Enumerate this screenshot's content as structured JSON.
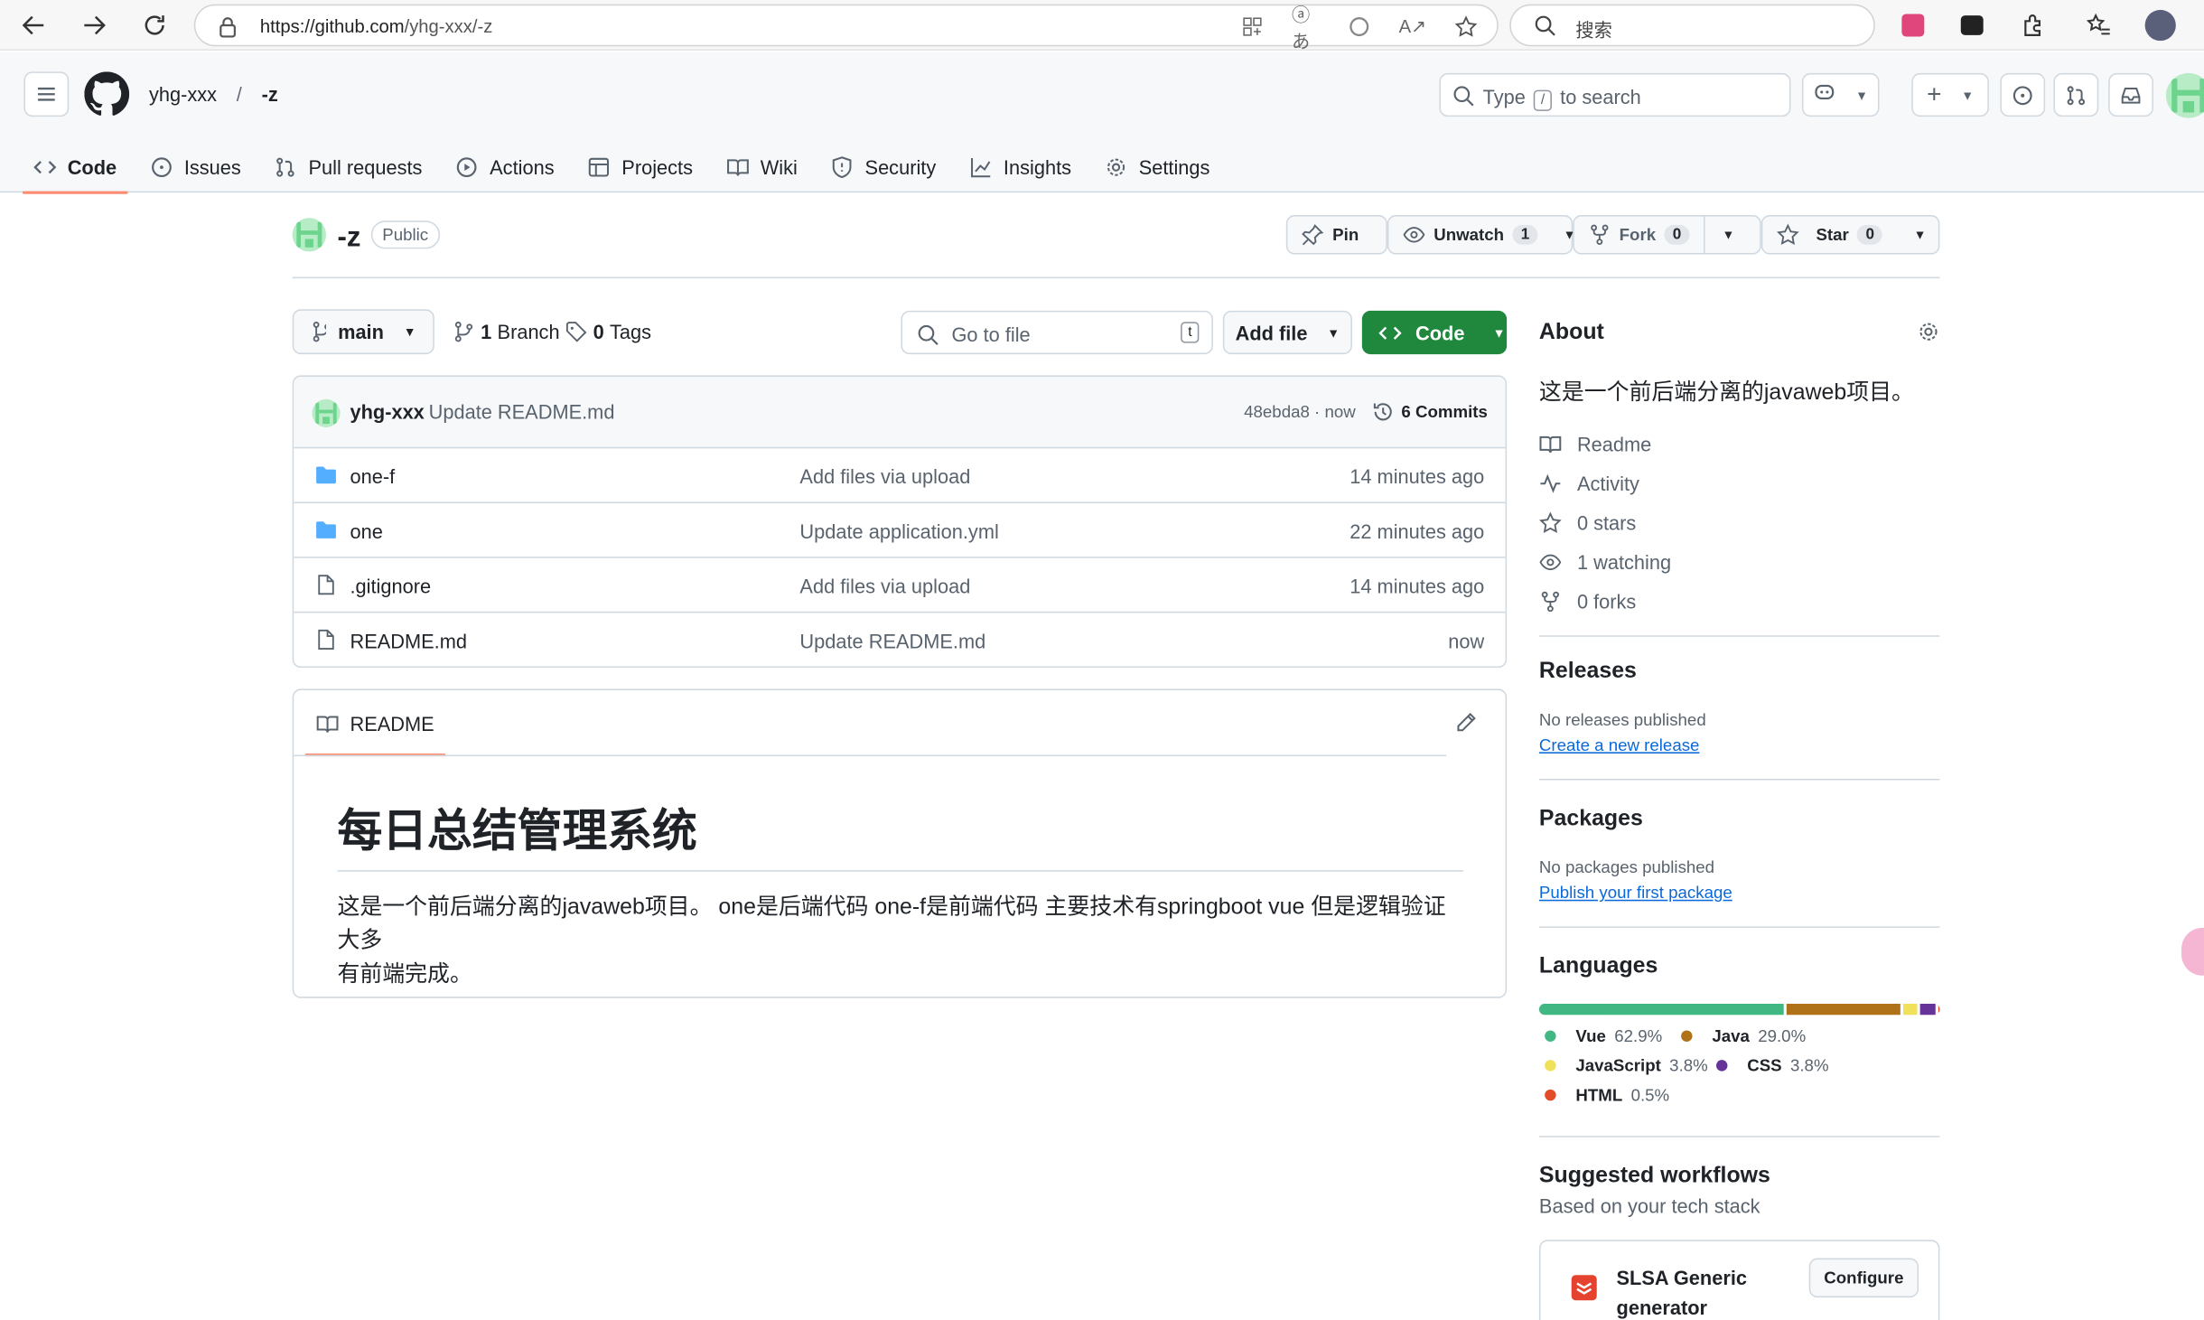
{
  "browser": {
    "url_host": "https://github.com",
    "url_path": "/yhg-xxx/-z",
    "search_placeholder": "搜索"
  },
  "header": {
    "owner": "yhg-xxx",
    "separator": "/",
    "repo": "-z",
    "search_prefix": "Type",
    "search_key": "/",
    "search_suffix": "to search"
  },
  "tabs": [
    {
      "label": "Code"
    },
    {
      "label": "Issues"
    },
    {
      "label": "Pull requests"
    },
    {
      "label": "Actions"
    },
    {
      "label": "Projects"
    },
    {
      "label": "Wiki"
    },
    {
      "label": "Security"
    },
    {
      "label": "Insights"
    },
    {
      "label": "Settings"
    }
  ],
  "repo_header": {
    "name": "-z",
    "visibility": "Public",
    "pin_label": "Pin",
    "unwatch_label": "Unwatch",
    "watch_count": "1",
    "fork_label": "Fork",
    "fork_count": "0",
    "star_label": "Star",
    "star_count": "0"
  },
  "toolbar": {
    "branch": "main",
    "branch_count": "1",
    "branch_word": "Branch",
    "tag_count": "0",
    "tag_word": "Tags",
    "goto_placeholder": "Go to file",
    "goto_key": "t",
    "add_file": "Add file",
    "code": "Code"
  },
  "commit": {
    "user": "yhg-xxx",
    "message": "Update README.md",
    "sha_time": "48ebda8 · now",
    "commits": "6 Commits"
  },
  "files": [
    {
      "name": "one-f",
      "type": "folder",
      "message": "Add files via upload",
      "time": "14 minutes ago"
    },
    {
      "name": "one",
      "type": "folder",
      "message": "Update application.yml",
      "time": "22 minutes ago"
    },
    {
      "name": ".gitignore",
      "type": "file",
      "message": "Add files via upload",
      "time": "14 minutes ago"
    },
    {
      "name": "README.md",
      "type": "file",
      "message": "Update README.md",
      "time": "now"
    }
  ],
  "readme": {
    "tab": "README",
    "title": "每日总结管理系统",
    "line1": "这是一个前后端分离的javaweb项目。 one是后端代码 one-f是前端代码 主要技术有springboot vue 但是逻辑验证大多",
    "line2": "有前端完成。"
  },
  "about": {
    "title": "About",
    "description": "这是一个前后端分离的javaweb项目。",
    "items": [
      {
        "label": "Readme"
      },
      {
        "label": "Activity"
      },
      {
        "label": "0 stars"
      },
      {
        "label": "1 watching"
      },
      {
        "label": "0 forks"
      }
    ]
  },
  "releases": {
    "title": "Releases",
    "status": "No releases published",
    "link": "Create a new release"
  },
  "packages": {
    "title": "Packages",
    "status": "No packages published",
    "link": "Publish your first package"
  },
  "languages": {
    "title": "Languages",
    "items": [
      {
        "name": "Vue",
        "pct": "62.9%",
        "value": 62.9,
        "color": "#41b883"
      },
      {
        "name": "Java",
        "pct": "29.0%",
        "value": 29.0,
        "color": "#b07219"
      },
      {
        "name": "JavaScript",
        "pct": "3.8%",
        "value": 3.8,
        "color": "#f1e05a"
      },
      {
        "name": "CSS",
        "pct": "3.8%",
        "value": 3.8,
        "color": "#663399"
      },
      {
        "name": "HTML",
        "pct": "0.5%",
        "value": 0.5,
        "color": "#e34c26"
      }
    ]
  },
  "workflows": {
    "title": "Suggested workflows",
    "subtitle": "Based on your tech stack",
    "item_name": "SLSA Generic generator",
    "item_button": "Configure"
  },
  "colors": {
    "accent_green": "#1f883d",
    "tab_underline": "#fd8c73",
    "link_blue": "#0969da",
    "folder_blue": "#54aeff"
  }
}
